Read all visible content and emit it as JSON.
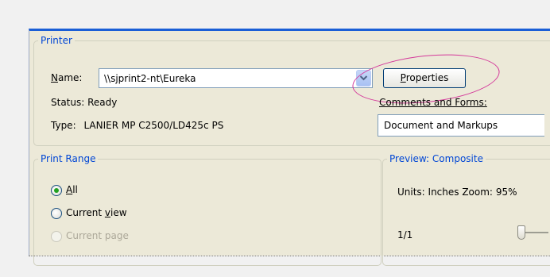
{
  "printer": {
    "legend": "Printer",
    "name_label_prefix": "",
    "name_label_mnemonic": "N",
    "name_label_rest": "ame:",
    "name_value": "\\\\sjprint2-nt\\Eureka",
    "properties_mnemonic": "P",
    "properties_rest": "roperties",
    "status_label": "Status:",
    "status_value": "Ready",
    "type_label": "Type:",
    "type_value": "LANIER MP C2500/LD425c PS",
    "comments_label": "Comments and Forms:",
    "comments_value": "Document and Markups"
  },
  "print_range": {
    "legend": "Print Range",
    "all_mnemonic": "A",
    "all_rest": "ll",
    "current_view_prefix": "Current ",
    "current_view_mnemonic": "v",
    "current_view_rest": "iew",
    "current_page": "Current page"
  },
  "preview": {
    "legend": "Preview: Composite",
    "units_zoom": "Units: Inches Zoom:",
    "zoom_value": "95%",
    "page_indicator": "1/1"
  },
  "colors": {
    "accent": "#0046d5",
    "highlight_ellipse": "#d4389a",
    "selected_radio": "#21a121"
  }
}
